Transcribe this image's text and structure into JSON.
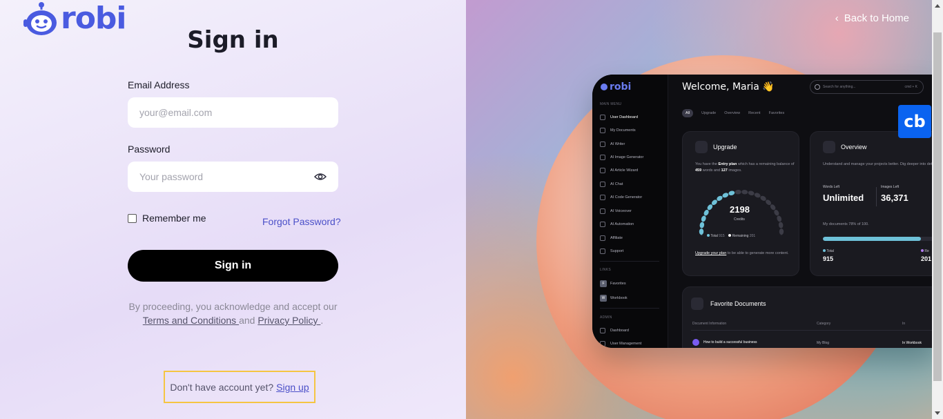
{
  "brand": {
    "name": "robi",
    "color": "#4a5be0"
  },
  "form": {
    "title": "Sign in",
    "email": {
      "label": "Email Address",
      "placeholder": "your@email.com",
      "value": ""
    },
    "password": {
      "label": "Password",
      "placeholder": "Your password",
      "value": ""
    },
    "remember_label": "Remember me",
    "remember_checked": false,
    "forgot_label": "Forgot Password?",
    "submit_label": "Sign in",
    "legal": {
      "prefix": "By proceeding, you acknowledge and accept our",
      "terms": "Terms and Conditions ",
      "and": "and",
      "privacy": "Privacy Policy ",
      "suffix": "."
    },
    "signup": {
      "prompt": "Don't have account yet?",
      "link": "Sign up"
    }
  },
  "header": {
    "back_label": "Back to Home"
  },
  "preview": {
    "brand": "robi",
    "welcome": "Welcome, Maria 👋",
    "search_placeholder": "Search for anything...",
    "search_shortcut": "cmd + K",
    "sections": {
      "main": "MAIN MENU",
      "links": "LINKS",
      "admin": "ADMIN"
    },
    "menu": [
      "User Dashboard",
      "My Documents",
      "AI Writer",
      "AI Image Generator",
      "AI Article Wizard",
      "AI Chat",
      "AI Code Generator",
      "AI Voiceover",
      "AI Automation",
      "Affiliate",
      "Support"
    ],
    "links": [
      {
        "badge": "F",
        "label": "Favorites"
      },
      {
        "badge": "W",
        "label": "Workbook"
      }
    ],
    "admin": [
      "Dashboard",
      "User Management"
    ],
    "tabs": [
      "All",
      "Upgrade",
      "Overview",
      "Recent",
      "Favorites"
    ],
    "upgrade": {
      "title": "Upgrade",
      "text_1": "You have the",
      "plan": "Entry plan",
      "text_2": "which has a remaining balance of",
      "words": "459",
      "text_3": "words and",
      "images": "127",
      "text_4": "images.",
      "credits_value": "2198",
      "credits_label": "Credits",
      "total_label": "Total",
      "total_value": "915",
      "remaining_label": "Remaining",
      "remaining_value": "201",
      "footer_link": "Upgrade your plan",
      "footer_text": "to be able to generate more content."
    },
    "overview": {
      "title": "Overview",
      "text": "Understand and manage your projects better. Dig deeper into details.",
      "words_left_label": "Words Left",
      "words_left_value": "Unlimited",
      "images_left_label": "Images Left",
      "images_left_value": "36,371",
      "docs_text": "My documents 78% of 100.",
      "docs_progress": 0.78,
      "total_label": "Total",
      "total_value": "915",
      "re_label": "Re",
      "re_value": "201"
    },
    "favorites": {
      "title": "Favorite Documents",
      "columns": [
        "Document Information",
        "Category",
        "In"
      ],
      "rows": [
        {
          "name": "How to build a successful business",
          "category": "My Blog",
          "in": "In Workbook"
        }
      ]
    },
    "badge": "cb"
  }
}
